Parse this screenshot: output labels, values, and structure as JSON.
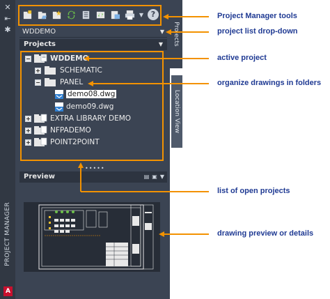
{
  "strip": {
    "title": "PROJECT MANAGER",
    "logo": "A"
  },
  "project_list": {
    "selected": "WDDEMO"
  },
  "projects_section": {
    "title": "Projects"
  },
  "tree": [
    {
      "label": "WDDEMO"
    },
    {
      "label": "SCHEMATIC"
    },
    {
      "label": "PANEL"
    },
    {
      "label": "demo08.dwg"
    },
    {
      "label": "demo09.dwg"
    },
    {
      "label": "EXTRA LIBRARY DEMO"
    },
    {
      "label": "NFPADEMO"
    },
    {
      "label": "POINT2POINT"
    }
  ],
  "preview_section": {
    "title": "Preview"
  },
  "tabs": {
    "projects": "Projects",
    "location": "Location View"
  },
  "toolbar": {
    "help_label": "?"
  },
  "annotations": {
    "tools": "Project Manager tools",
    "dropdown": "project list drop-down",
    "active": "active project",
    "folders": "organize drawings in folders",
    "open_projects": "list of open projects",
    "preview": "drawing preview or details"
  },
  "colors": {
    "accent": "#f39200",
    "annotation_text": "#1f3a93",
    "panel_bg": "#3b4453",
    "folder": "#e8e8e8"
  },
  "icons": [
    "new-project-icon",
    "open-project-icon",
    "add-drawings-icon",
    "refresh-icon",
    "task-list-icon",
    "update-icon",
    "publish-icon",
    "plot-icon",
    "help-icon"
  ]
}
